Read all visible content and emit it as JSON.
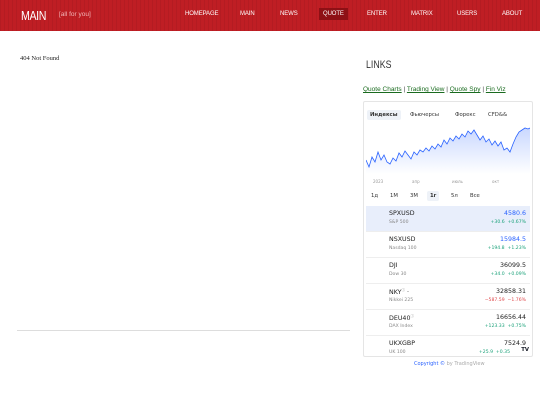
{
  "site": {
    "title": "MAIN",
    "tagline": "[all for you]"
  },
  "nav": {
    "items": [
      {
        "label": "HOMEPAGE"
      },
      {
        "label": "MAIN"
      },
      {
        "label": "NEWS"
      },
      {
        "label": "QUOTE"
      },
      {
        "label": "ENTER"
      },
      {
        "label": "MATRIX"
      },
      {
        "label": "USERS"
      },
      {
        "label": "ABOUT"
      }
    ],
    "active_index": 3
  },
  "main": {
    "message": "404 Not Found"
  },
  "links": {
    "title": "LINKS",
    "items": [
      {
        "label": "Quote Charts"
      },
      {
        "label": "Trading View"
      },
      {
        "label": "Quote Spy"
      },
      {
        "label": "Fin Viz"
      }
    ],
    "separator": "|"
  },
  "widget": {
    "tabs": [
      {
        "label": "Индексы"
      },
      {
        "label": "Фьючерсы"
      },
      {
        "label": "Форекс"
      },
      {
        "label": "CFD&&"
      }
    ],
    "active_tab": 0,
    "x_axis_labels": [
      "2023",
      "апр",
      "июль",
      "окт"
    ],
    "ranges": [
      {
        "label": "1д"
      },
      {
        "label": "1М"
      },
      {
        "label": "3М"
      },
      {
        "label": "1г"
      },
      {
        "label": "5л"
      },
      {
        "label": "Все"
      }
    ],
    "active_range": 3,
    "sparkline_color": "#2962ff",
    "rows": [
      {
        "symbol": "SPXUSD",
        "desc": "S&P 500",
        "price": "4580.6",
        "chg_abs": "+30.6",
        "chg_pct": "+0.67%",
        "dir": "up",
        "selected": true
      },
      {
        "symbol": "NSXUSD",
        "desc": "Nasdaq 100",
        "price": "15984.5",
        "chg_abs": "+194.8",
        "chg_pct": "+1.23%",
        "dir": "up"
      },
      {
        "symbol": "DJI",
        "desc": "Dow 30",
        "price": "36099.5",
        "chg_abs": "+34.0",
        "chg_pct": "+0.09%",
        "dir": "up"
      },
      {
        "symbol": "NKY",
        "desc": "Nikkei 225",
        "price": "32858.31",
        "chg_abs": "−587.59",
        "chg_pct": "−1.76%",
        "dir": "down"
      },
      {
        "symbol": "DEU40",
        "desc": "DAX Index",
        "price": "16656.44",
        "chg_abs": "+123.33",
        "chg_pct": "+0.75%",
        "dir": "up"
      },
      {
        "symbol": "UKXGBP",
        "desc": "UK 100",
        "price": "7524.9",
        "chg_abs": "+25.9",
        "chg_pct": "+0.35",
        "dir": "up"
      }
    ],
    "logo": "TV"
  },
  "footer": {
    "copyright_link": "Copyright ©",
    "by": "by TradingView"
  }
}
